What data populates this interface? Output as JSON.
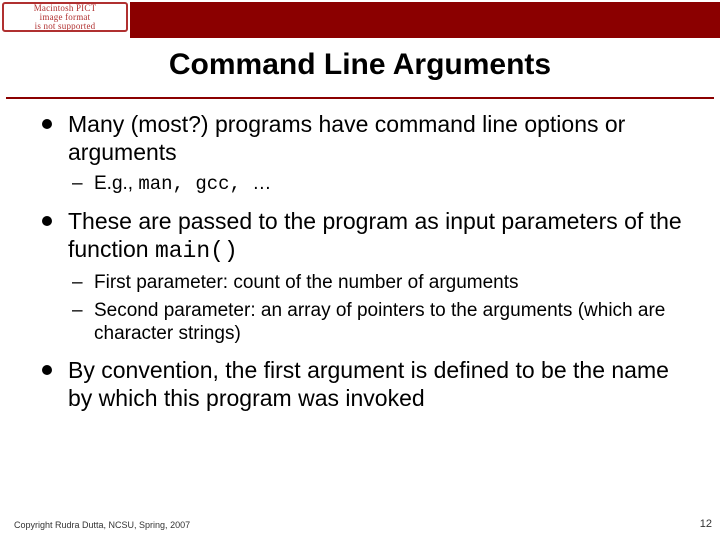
{
  "badge": {
    "line1": "Macintosh PICT",
    "line2": "image format",
    "line3": "is not supported"
  },
  "title": "Command Line Arguments",
  "bullets": [
    {
      "text": "Many (most?) programs have command line options or arguments",
      "sub": [
        {
          "prefix": "E.g., ",
          "code": "man, gcc, ",
          "suffix": "…"
        }
      ]
    },
    {
      "text_pre": "These are passed to the program as input parameters of the function ",
      "code": "main()",
      "sub": [
        {
          "text": "First parameter: count of the number of arguments"
        },
        {
          "text": "Second parameter: an array of pointers to the arguments (which are character strings)"
        }
      ]
    },
    {
      "text": "By convention, the first argument is defined to be the name by which this program was invoked"
    }
  ],
  "footer": {
    "copyright": "Copyright Rudra Dutta, NCSU, Spring, 2007",
    "page": "12"
  }
}
